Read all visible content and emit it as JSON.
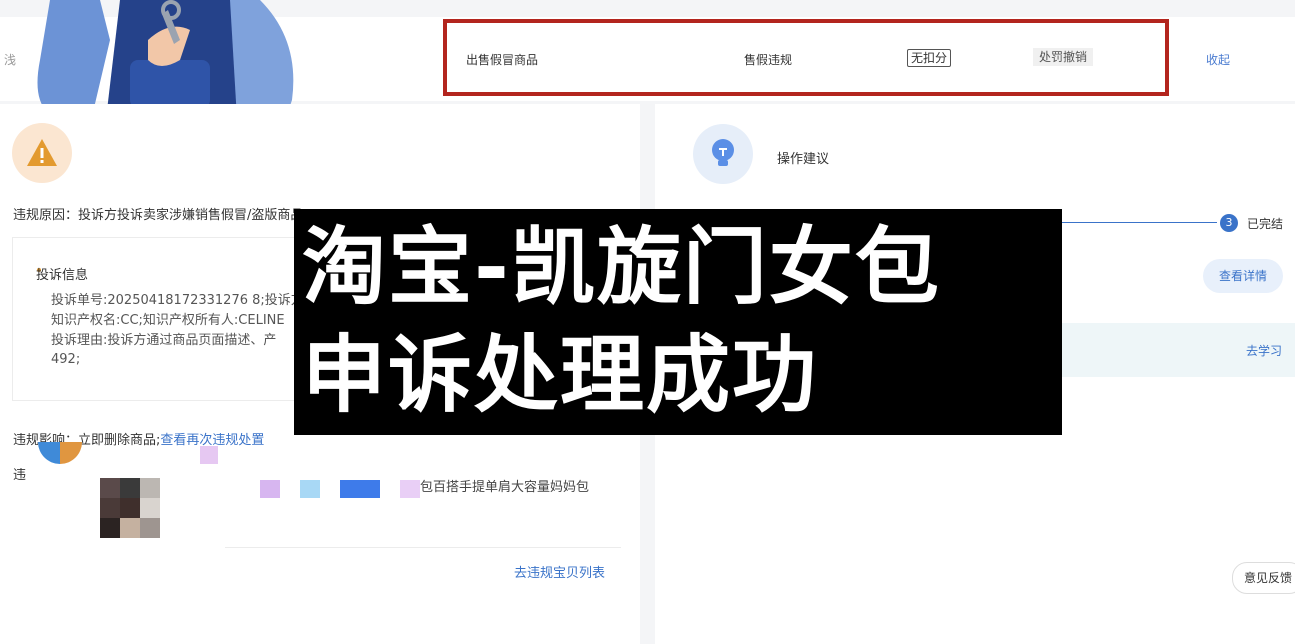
{
  "top_row": {
    "left_cut_text": "浅",
    "reason": "出售假冒商品",
    "type": "售假违规",
    "points": "无扣分",
    "status": "处罚撤销",
    "collapse": "收起"
  },
  "left": {
    "reason_label": "违规原因：投诉方投诉卖家涉嫌销售假冒/盗版商品",
    "info_title": "投诉信息",
    "info_lines": [
      "投诉单号:20250418172331276 8;投诉方",
      "知识产权名:CC;知识产权所有人:CELINE",
      "投诉理由:投诉方通过商品页面描述、产",
      "492;"
    ],
    "impact_label": "违规影响：",
    "impact_text": "立即删除商品;",
    "impact_link": "查看再次违规处置",
    "illegal_cut": "违",
    "goods_name": "包百搭手提单肩大容量妈妈包",
    "goods_link": "去违规宝贝列表"
  },
  "right": {
    "advice_title": "操作建议",
    "step_number": "3",
    "step_label": "已完结",
    "detail_button": "查看详情",
    "learn_link": "去学习",
    "feedback_button": "意见反馈"
  },
  "overlay": {
    "line1": "淘宝-凯旋门女包",
    "line2": "申诉处理成功"
  },
  "colors": {
    "accent": "#3a73c9",
    "highlight_box": "#b3251e",
    "warning": "#e39a2f",
    "overlay_bg": "#000000"
  }
}
